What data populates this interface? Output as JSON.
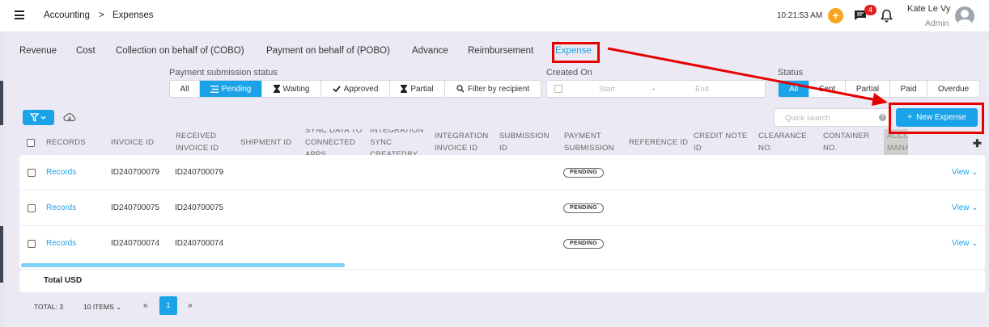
{
  "breadcrumb": {
    "root": "Accounting",
    "separator": ">",
    "current": "Expenses"
  },
  "header": {
    "time": "10:21:53 AM",
    "notification_count": "4",
    "user_name": "Kate Le Vy",
    "user_role": "Admin"
  },
  "tabs": [
    "Revenue",
    "Cost",
    "Collection on behalf of (COBO)",
    "Payment on behalf of (POBO)",
    "Advance",
    "Reimbursement",
    "Expense"
  ],
  "filters": {
    "payment_status_label": "Payment submission status",
    "payment_status_options": [
      "All",
      "Pending",
      "Waiting",
      "Approved",
      "Partial",
      "Filter by recipient"
    ],
    "payment_status_selected": "Pending",
    "created_on_label": "Created On",
    "date_start_placeholder": "Start",
    "date_separator": "-",
    "date_end_placeholder": "End",
    "status_label": "Status",
    "status_options": [
      "All",
      "Sent",
      "Partial",
      "Paid",
      "Overdue"
    ],
    "status_selected": "All"
  },
  "toolbar": {
    "search_placeholder": "Quick search",
    "new_button_label": "New Expense"
  },
  "table": {
    "columns": {
      "records": "RECORDS",
      "invoice_id": "INVOICE ID",
      "received_invoice_id": "RECEIVED INVOICE ID",
      "shipment_id": "SHIPMENT ID",
      "sync_data": "SYNC DATA TO CONNECTED APPS",
      "integration_sync_created_by": "INTEGRATION SYNC CREATEDBY",
      "integration_invoice_id": "INTEGRATION INVOICE ID",
      "submission_id": "SUBMISSION ID",
      "payment_submission": "PAYMENT SUBMISSION",
      "reference_id": "REFERENCE ID",
      "credit_note_id": "CREDIT NOTE ID",
      "clearance_no": "CLEARANCE NO.",
      "container_no": "CONTAINER NO.",
      "account_manager": "ACCOUNT MANA"
    },
    "rows": [
      {
        "records": "Records",
        "invoice_id": "ID240700079",
        "received_invoice_id": "ID240700079",
        "payment_submission": "PENDING",
        "action": "View"
      },
      {
        "records": "Records",
        "invoice_id": "ID240700075",
        "received_invoice_id": "ID240700075",
        "payment_submission": "PENDING",
        "action": "View"
      },
      {
        "records": "Records",
        "invoice_id": "ID240700074",
        "received_invoice_id": "ID240700074",
        "payment_submission": "PENDING",
        "action": "View"
      }
    ],
    "total_label": "Total USD"
  },
  "pagination": {
    "total": "TOTAL: 3",
    "page_size": "10 ITEMS",
    "prev": "«",
    "current_page": "1",
    "next": "»"
  },
  "colors": {
    "accent": "#1aa3e8",
    "annotation": "#e60000",
    "badge": "#e02020",
    "plus_button": "#f5a623"
  }
}
